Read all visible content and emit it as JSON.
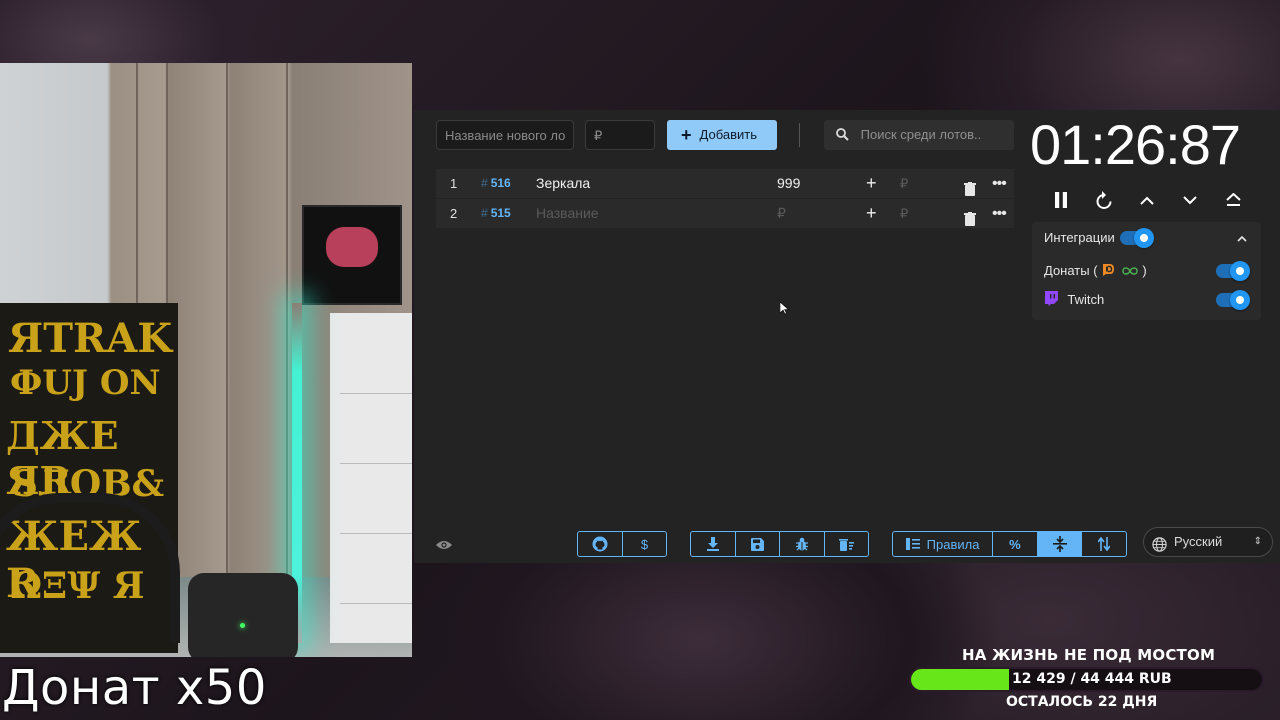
{
  "webcam": {
    "caption": "Донат х50"
  },
  "auction": {
    "new_lot_placeholder": "Название нового ло",
    "amount_placeholder": "₽",
    "add_label": "Добавить",
    "search_placeholder": "Поиск среди лотов..",
    "lots": [
      {
        "index": "1",
        "id": "516",
        "name": "Зеркала",
        "amount": "999",
        "currency": "₽"
      },
      {
        "index": "2",
        "id": "515",
        "name": "Название",
        "amount": "₽",
        "currency": "₽"
      }
    ],
    "id_prefix": "#"
  },
  "toolbar": {
    "rules_label": "Правила",
    "percent_label": "%",
    "language": "Русский"
  },
  "timer": {
    "value": "01:26:87"
  },
  "integrations": {
    "title": "Интеграции",
    "donations_label": "Донаты (",
    "donations_suffix": ")",
    "twitch_label": "Twitch"
  },
  "goal": {
    "title": "НА ЖИЗНЬ НЕ ПОД МОСТОМ",
    "progress_text": "12 429 / 44 444 RUB",
    "remaining": "ОСТАЛОСЬ 22 ДНЯ",
    "current": 12429,
    "target": 44444,
    "fill_color": "#67e61a"
  },
  "colors": {
    "accent": "#64b5f6",
    "add_button": "#90caf9",
    "toggle_on": "#2196f3"
  }
}
